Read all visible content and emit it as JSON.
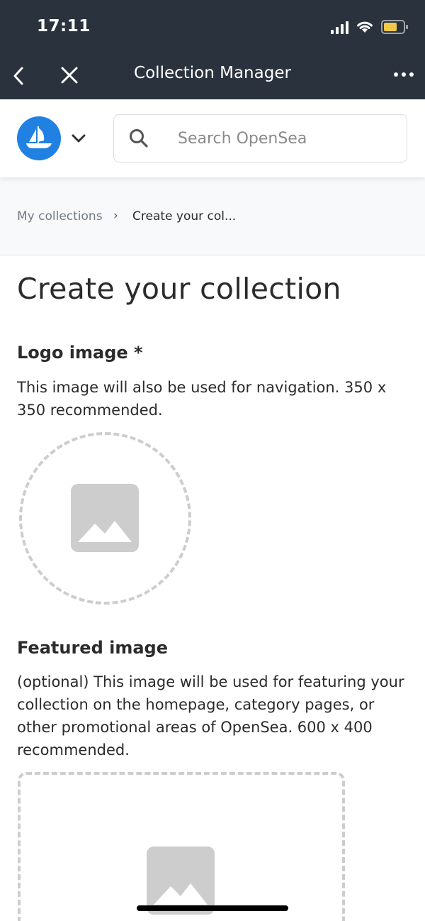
{
  "status_bar": {
    "time": "17:11",
    "icons": [
      "signal-icon",
      "wifi-icon",
      "battery-icon"
    ],
    "battery_color": "#f2c94c"
  },
  "nav": {
    "title": "Collection Manager",
    "back_icon": "chevron-left-icon",
    "close_icon": "close-icon",
    "more_icon": "more-horizontal-icon"
  },
  "header": {
    "logo_icon": "opensea-logo-icon",
    "brand_color": "#2081e2",
    "dropdown_icon": "chevron-down-icon",
    "search": {
      "placeholder": "Search OpenSea",
      "value": ""
    }
  },
  "breadcrumb": {
    "items": [
      "My collections",
      "Create your col..."
    ],
    "separator": "›"
  },
  "main": {
    "title": "Create your collection",
    "logo_image": {
      "label": "Logo image *",
      "description": "This image will also be used for navigation. 350 x 350 recommended.",
      "placeholder_icon": "image-placeholder-icon"
    },
    "featured_image": {
      "label": "Featured image",
      "description": "(optional) This image will be used for featuring your collection on the homepage, category pages, or other promotional areas of OpenSea. 600 x 400 recommended.",
      "placeholder_icon": "image-placeholder-icon"
    }
  },
  "colors": {
    "topbar": "#2a333d",
    "placeholder_gray": "#cdcdcd"
  }
}
